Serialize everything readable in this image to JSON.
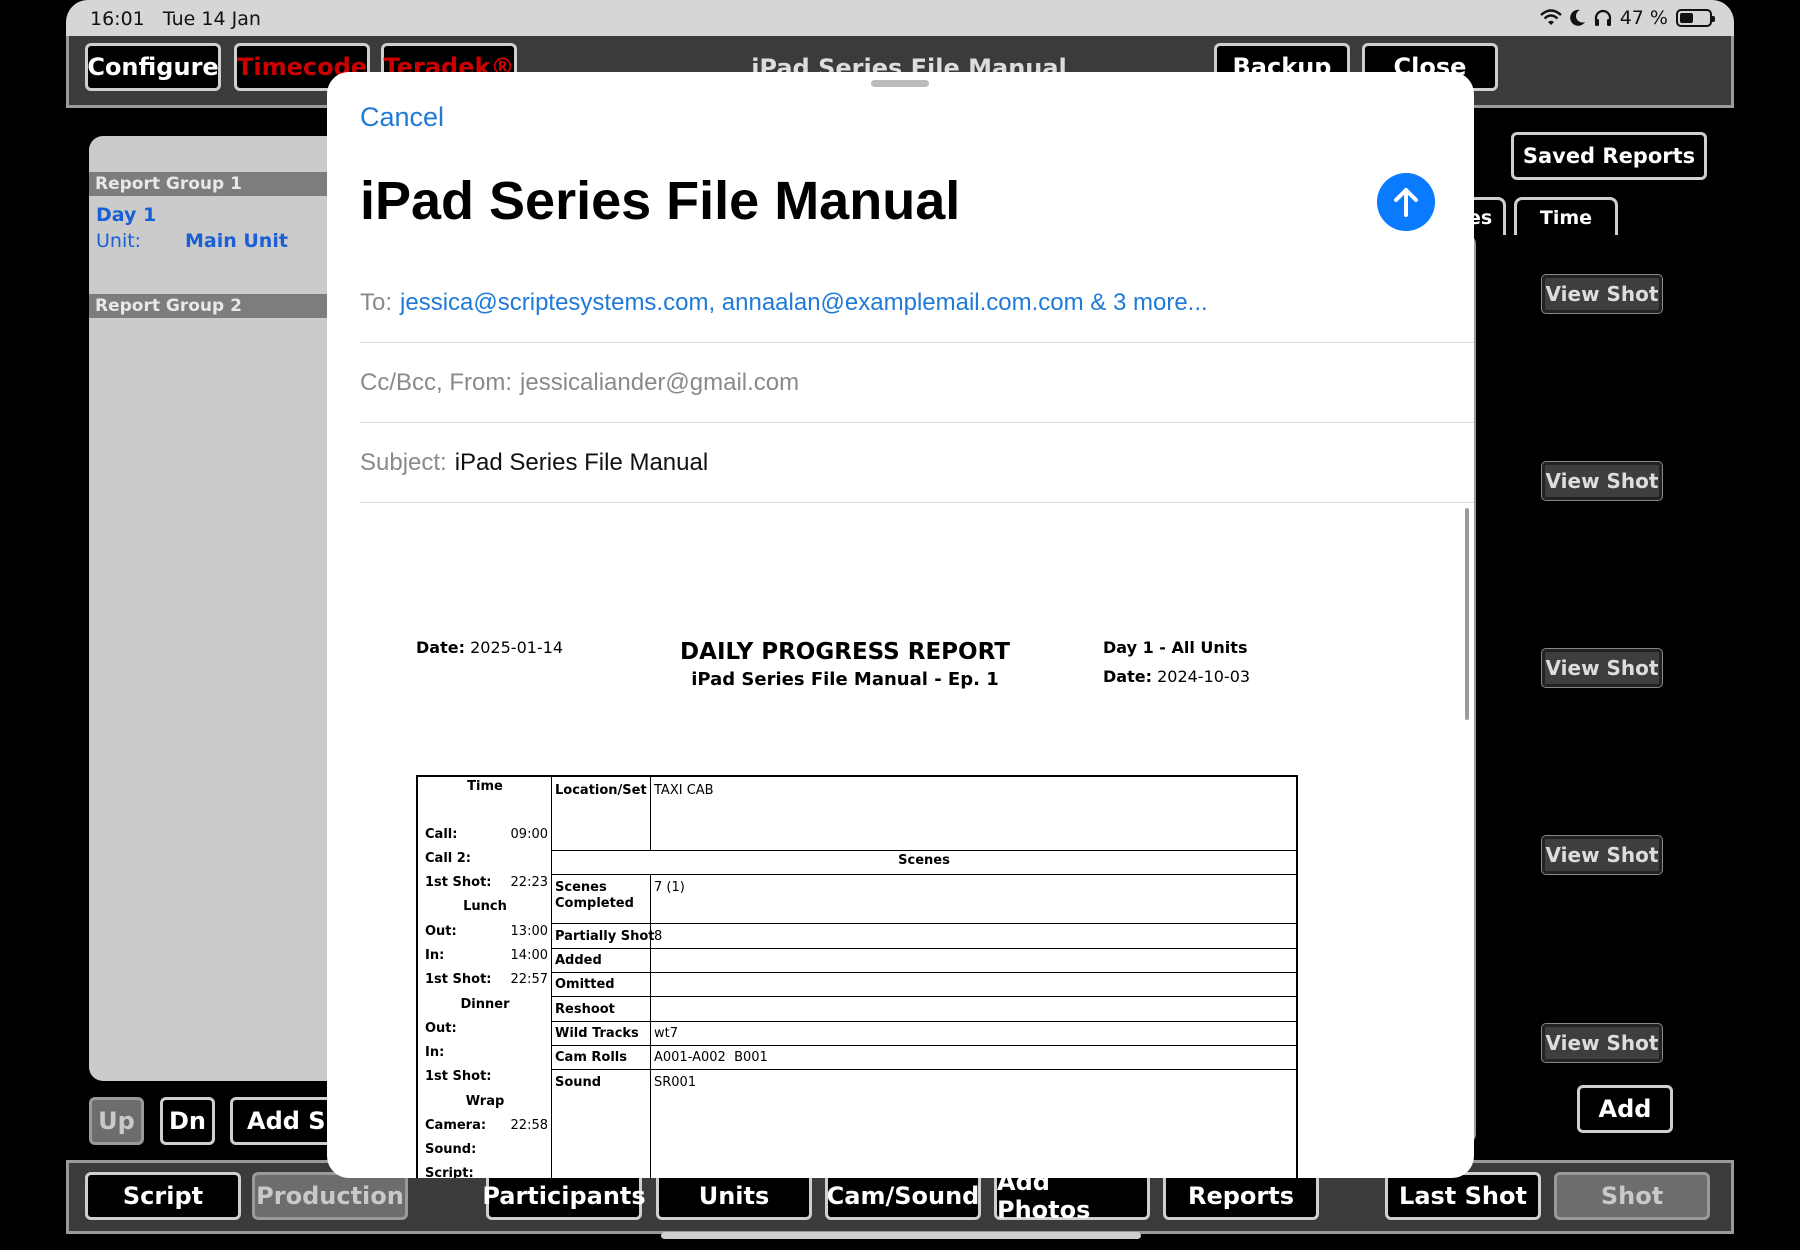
{
  "status_bar": {
    "time": "16:01",
    "date": "Tue 14 Jan",
    "battery": "47 %",
    "battery_level": 0.47
  },
  "toolbar": {
    "configure": "Configure",
    "timecode": "Timecode",
    "teradek": "Teradek®",
    "title": "iPad Series File Manual",
    "backup": "Backup",
    "close": "Close"
  },
  "left_panel": {
    "group1": "Report Group 1",
    "day": "Day 1",
    "unit_label": "Unit:",
    "unit_value": "Main Unit",
    "group2": "Report Group 2"
  },
  "left_controls": {
    "up": "Up",
    "dn": "Dn",
    "add_shot": "Add Sh"
  },
  "right_panel": {
    "saved_reports": "Saved Reports",
    "tab_notes": "od Notes",
    "tab_time": "Time",
    "view_shot": "View Shot",
    "add": "Add"
  },
  "bottom_bar": {
    "script": "Script",
    "production": "Production",
    "participants": "Participants",
    "units": "Units",
    "cam_sound": "Cam/Sound",
    "add_photos": "Add Photos",
    "reports": "Reports",
    "last_shot": "Last Shot",
    "shot": "Shot"
  },
  "compose": {
    "cancel": "Cancel",
    "title": "iPad Series File Manual",
    "to_label": "To:",
    "to_value": "jessica@scriptesystems.com, annaalan@examplemail.com.com & 3 more...",
    "cc_label": "Cc/Bcc, From:",
    "cc_value": "jessicaliander@gmail.com",
    "subject_label": "Subject:",
    "subject_value": "iPad Series File Manual"
  },
  "report": {
    "date_label": "Date:",
    "date_value": "2025-01-14",
    "title": "DAILY PROGRESS REPORT",
    "subtitle": "iPad Series File Manual - Ep. 1",
    "day_units": "Day 1 - All Units",
    "shoot_date_label": "Date:",
    "shoot_date_value": "2024-10-03",
    "time_head": "Time",
    "call_label": "Call:",
    "call_value": "09:00",
    "call2_label": "Call 2:",
    "first_shot_label": "1st Shot:",
    "first_shot_value": "22:23",
    "lunch": "Lunch",
    "lunch_out_label": "Out:",
    "lunch_out_value": "13:00",
    "lunch_in_label": "In:",
    "lunch_in_value": "14:00",
    "lunch_first_shot_label": "1st Shot:",
    "lunch_first_shot_value": "22:57",
    "dinner": "Dinner",
    "dinner_out_label": "Out:",
    "dinner_in_label": "In:",
    "dinner_first_shot_label": "1st Shot:",
    "wrap": "Wrap",
    "camera_label": "Camera:",
    "camera_value": "22:58",
    "sound_label": "Sound:",
    "script_label": "Script:",
    "location_label": "Location/Set",
    "location_value": "TAXI CAB",
    "scenes_head": "Scenes",
    "scenes_completed_label1": "Scenes",
    "scenes_completed_label2": "Completed",
    "scenes_completed_value": "7 (1)",
    "partially_label": "Partially Shot",
    "partially_value": "8",
    "added_label": "Added",
    "omitted_label": "Omitted",
    "reshoot_label": "Reshoot",
    "wild_label": "Wild Tracks",
    "wild_value": "wt7",
    "camrolls_label": "Cam Rolls",
    "camrolls_value": "A001-A002  B001",
    "sound_row_label": "Sound",
    "sound_row_value": "SR001"
  }
}
